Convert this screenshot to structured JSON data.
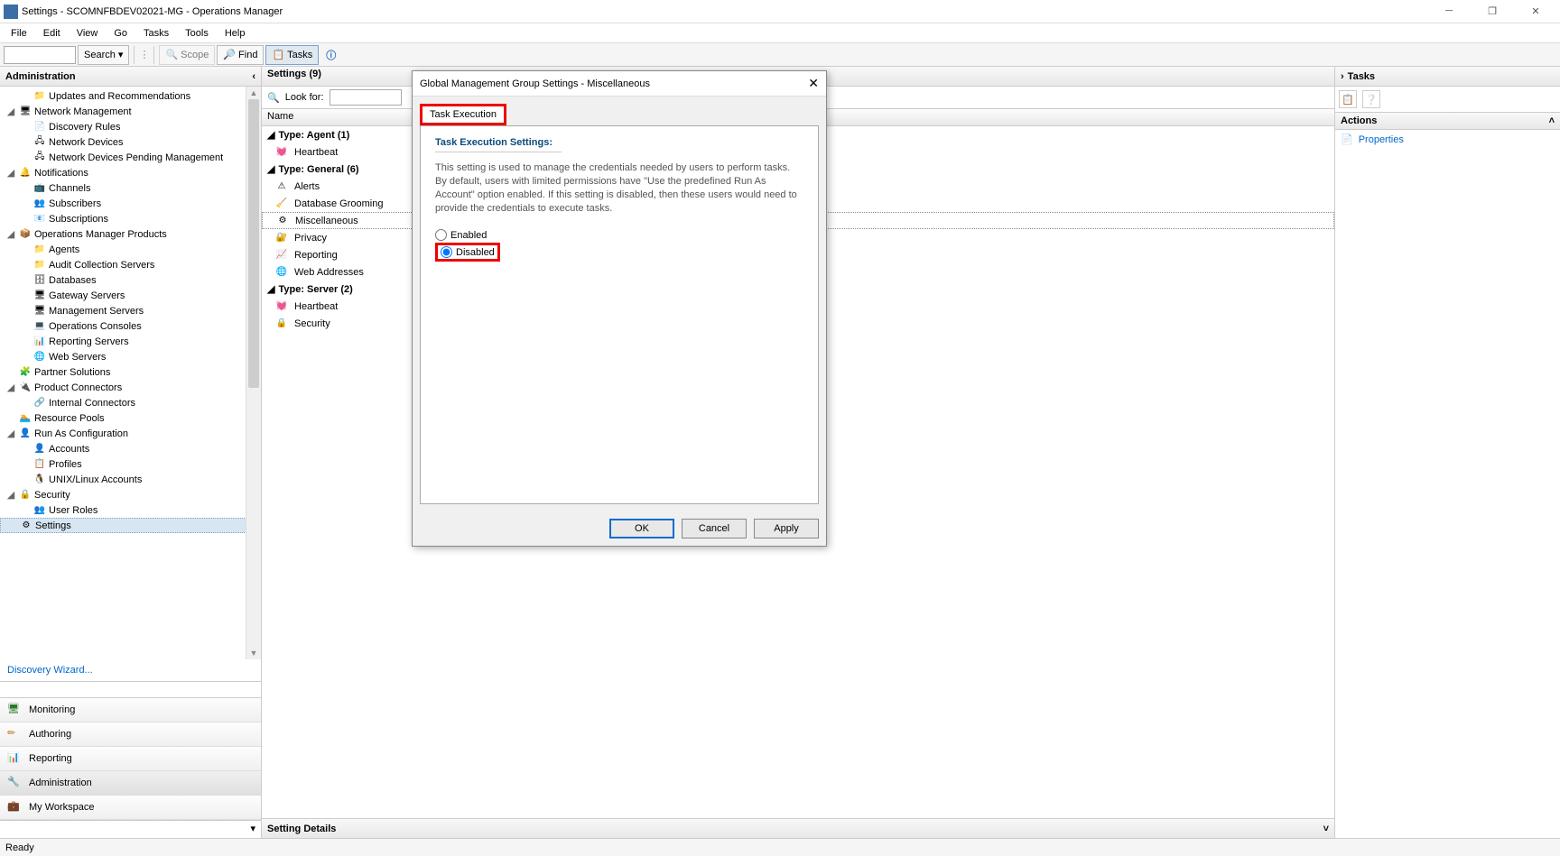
{
  "window": {
    "title": "Settings - SCOMNFBDEV02021-MG - Operations Manager"
  },
  "menu": {
    "items": [
      "File",
      "Edit",
      "View",
      "Go",
      "Tasks",
      "Tools",
      "Help"
    ]
  },
  "toolbar": {
    "search": "Search ▾",
    "scope": "Scope",
    "find": "Find",
    "tasks": "Tasks"
  },
  "nav": {
    "header": "Administration",
    "items": [
      {
        "l": 1,
        "t": "",
        "i": "📁",
        "txt": "Updates and Recommendations"
      },
      {
        "l": 0,
        "t": "◢",
        "i": "🖥",
        "txt": "Network Management"
      },
      {
        "l": 1,
        "t": "",
        "i": "📄",
        "txt": "Discovery Rules"
      },
      {
        "l": 1,
        "t": "",
        "i": "🖧",
        "txt": "Network Devices"
      },
      {
        "l": 1,
        "t": "",
        "i": "🖧",
        "txt": "Network Devices Pending Management"
      },
      {
        "l": 0,
        "t": "◢",
        "i": "🔔",
        "txt": "Notifications"
      },
      {
        "l": 1,
        "t": "",
        "i": "📺",
        "txt": "Channels"
      },
      {
        "l": 1,
        "t": "",
        "i": "👥",
        "txt": "Subscribers"
      },
      {
        "l": 1,
        "t": "",
        "i": "📧",
        "txt": "Subscriptions"
      },
      {
        "l": 0,
        "t": "◢",
        "i": "📦",
        "txt": "Operations Manager Products"
      },
      {
        "l": 1,
        "t": "",
        "i": "📁",
        "txt": "Agents"
      },
      {
        "l": 1,
        "t": "",
        "i": "📁",
        "txt": "Audit Collection Servers"
      },
      {
        "l": 1,
        "t": "",
        "i": "🗄",
        "txt": "Databases"
      },
      {
        "l": 1,
        "t": "",
        "i": "🖥",
        "txt": "Gateway Servers"
      },
      {
        "l": 1,
        "t": "",
        "i": "🖥",
        "txt": "Management Servers"
      },
      {
        "l": 1,
        "t": "",
        "i": "💻",
        "txt": "Operations Consoles"
      },
      {
        "l": 1,
        "t": "",
        "i": "📊",
        "txt": "Reporting Servers"
      },
      {
        "l": 1,
        "t": "",
        "i": "🌐",
        "txt": "Web Servers"
      },
      {
        "l": 0,
        "t": "",
        "i": "🧩",
        "txt": "Partner Solutions"
      },
      {
        "l": 0,
        "t": "◢",
        "i": "🔌",
        "txt": "Product Connectors"
      },
      {
        "l": 1,
        "t": "",
        "i": "🔗",
        "txt": "Internal Connectors"
      },
      {
        "l": 0,
        "t": "",
        "i": "🏊",
        "txt": "Resource Pools"
      },
      {
        "l": 0,
        "t": "◢",
        "i": "👤",
        "txt": "Run As Configuration"
      },
      {
        "l": 1,
        "t": "",
        "i": "👤",
        "txt": "Accounts"
      },
      {
        "l": 1,
        "t": "",
        "i": "📋",
        "txt": "Profiles"
      },
      {
        "l": 1,
        "t": "",
        "i": "🐧",
        "txt": "UNIX/Linux Accounts"
      },
      {
        "l": 0,
        "t": "◢",
        "i": "🔒",
        "txt": "Security"
      },
      {
        "l": 1,
        "t": "",
        "i": "👥",
        "txt": "User Roles"
      },
      {
        "l": 0,
        "t": "",
        "i": "⚙",
        "txt": "Settings",
        "sel": true
      }
    ],
    "wizard": "Discovery Wizard...",
    "wunderbar": [
      {
        "icon": "🖥",
        "txt": "Monitoring",
        "c": "#2a7a2a"
      },
      {
        "icon": "✏",
        "txt": "Authoring",
        "c": "#c08030"
      },
      {
        "icon": "📊",
        "txt": "Reporting",
        "c": "#2a8a5a"
      },
      {
        "icon": "🔧",
        "txt": "Administration",
        "c": "#888",
        "sel": true
      },
      {
        "icon": "💼",
        "txt": "My Workspace",
        "c": "#888"
      }
    ]
  },
  "content": {
    "header": "Settings (9)",
    "lookfor": "Look for:",
    "colName": "Name",
    "groups": [
      {
        "hdr": "Type: Agent (1)",
        "rows": [
          {
            "i": "💓",
            "txt": "Heartbeat"
          }
        ]
      },
      {
        "hdr": "Type: General (6)",
        "rows": [
          {
            "i": "⚠",
            "txt": "Alerts"
          },
          {
            "i": "🧹",
            "txt": "Database Grooming"
          },
          {
            "i": "⚙",
            "txt": "Miscellaneous",
            "sel": true
          },
          {
            "i": "🔐",
            "txt": "Privacy"
          },
          {
            "i": "📈",
            "txt": "Reporting"
          },
          {
            "i": "🌐",
            "txt": "Web Addresses"
          }
        ]
      },
      {
        "hdr": "Type: Server (2)",
        "rows": [
          {
            "i": "💓",
            "txt": "Heartbeat"
          },
          {
            "i": "🔒",
            "txt": "Security"
          }
        ]
      }
    ],
    "detail": "Setting Details"
  },
  "tasks": {
    "header": "Tasks",
    "actions": "Actions",
    "properties": "Properties"
  },
  "dialog": {
    "title": "Global Management Group Settings - Miscellaneous",
    "tab": "Task Execution",
    "section": "Task Execution Settings:",
    "desc": "This setting is used to manage the credentials needed by users to perform tasks. By default, users with limited permissions have \"Use the predefined Run As Account\" option enabled. If this setting is disabled, then these users would need to provide the credentials to execute tasks.",
    "opt_enabled": "Enabled",
    "opt_disabled": "Disabled",
    "ok": "OK",
    "cancel": "Cancel",
    "apply": "Apply"
  },
  "status": "Ready"
}
